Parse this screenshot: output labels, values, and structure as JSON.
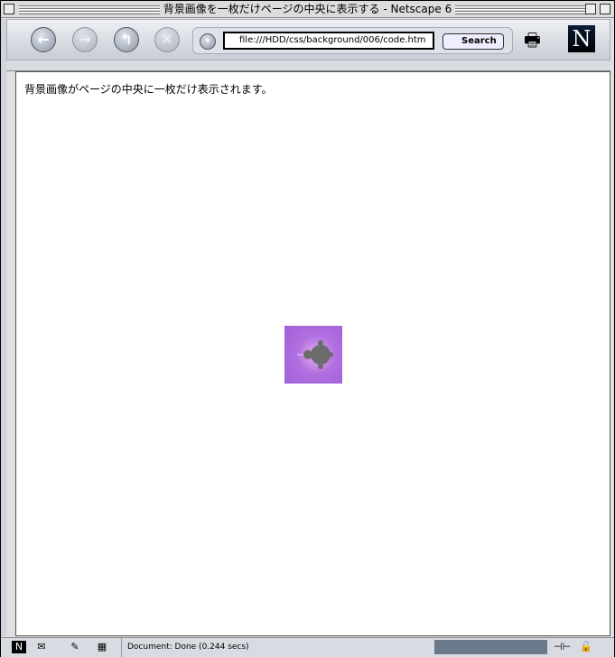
{
  "window": {
    "title": "背景画像を一枚だけページの中央に表示する - Netscape 6"
  },
  "toolbar": {
    "url": "file:///HDD/css/background/006/code.htm",
    "search_label": "Search",
    "logo": "N"
  },
  "content": {
    "text": "背景画像がページの中央に一枚だけ表示されます。"
  },
  "status": {
    "text": "Document: Done (0.244 secs)"
  }
}
